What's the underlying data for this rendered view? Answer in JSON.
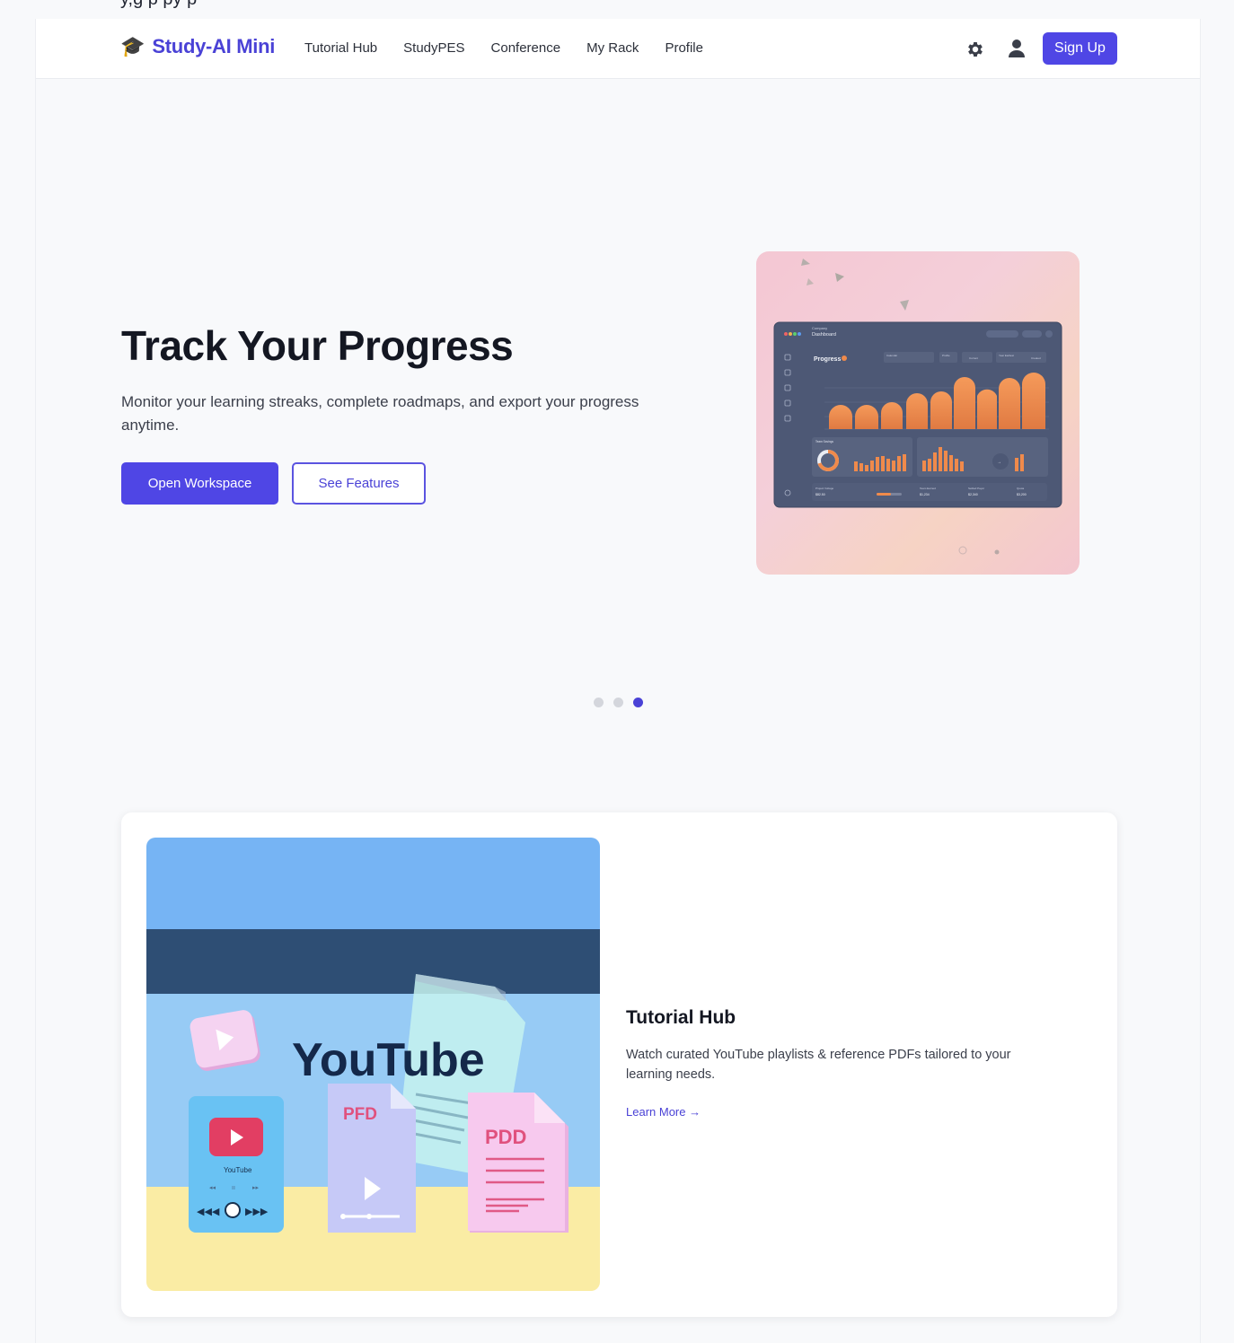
{
  "top_clipped_text": "y,g        p      py p",
  "header": {
    "brand_icon": "graduation-cap-icon",
    "brand_glyph": "🎓",
    "brand_name": "Study-AI Mini",
    "nav": [
      "Tutorial Hub",
      "StudyPES",
      "Conference",
      "My Rack",
      "Profile"
    ],
    "settings_icon": "gear-icon",
    "user_icon": "user-icon",
    "signup_label": "Sign Up"
  },
  "hero": {
    "title": "Track Your Progress",
    "description": "Monitor your learning streaks, complete roadmaps, and export your progress anytime.",
    "primary_button": "Open Workspace",
    "secondary_button": "See Features",
    "image": {
      "dashboard_company": "Company",
      "dashboard_title": "Dashboard",
      "panel_title": "Progress",
      "filter_labels": [
        "Calendar",
        "Profile",
        "Current",
        "Year Earliest",
        "Created"
      ],
      "widget_labels": [
        "Team Savings",
        "Weekly Wage",
        "Project Voltage",
        "Team Earned",
        "Settled Payer",
        "Quota"
      ],
      "widget_values": [
        "$82.50",
        "$1,234",
        "$2,340",
        "$3,200"
      ]
    },
    "carousel": {
      "total": 3,
      "active": 3
    }
  },
  "feature": {
    "title": "Tutorial Hub",
    "description": "Watch curated YouTube playlists & reference PDFs tailored to your learning needs.",
    "link": "Learn More →",
    "image": {
      "headline": "YouTube",
      "phone_label": "YouTube",
      "doc1_label": "PFD",
      "doc2_label": "PDD"
    }
  },
  "colors": {
    "brand": "#4a42d6",
    "primary": "#4f46e5",
    "accent_orange": "#f08a4b"
  }
}
